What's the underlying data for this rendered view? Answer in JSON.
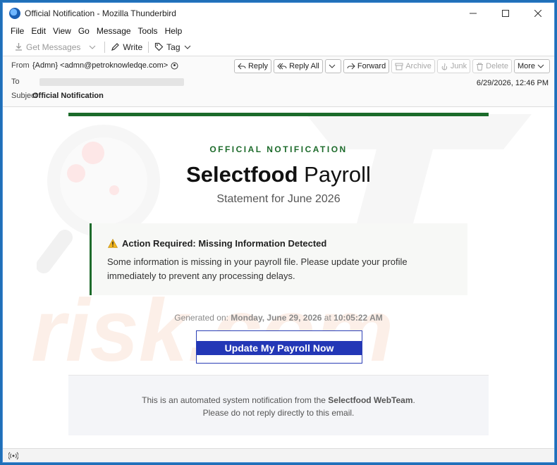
{
  "window": {
    "title": "Official Notification - Mozilla Thunderbird"
  },
  "menu": [
    "File",
    "Edit",
    "View",
    "Go",
    "Message",
    "Tools",
    "Help"
  ],
  "toolbar": {
    "get_messages": "Get Messages",
    "write": "Write",
    "tag": "Tag"
  },
  "header": {
    "from_label": "From",
    "from_value": "{Admn} <admn@petroknowledqe.com>",
    "to_label": "To",
    "subject_label": "Subject",
    "subject_value": "Official Notification",
    "date": "6/29/2026, 12:46 PM",
    "buttons": {
      "reply": "Reply",
      "reply_all": "Reply All",
      "forward": "Forward",
      "archive": "Archive",
      "junk": "Junk",
      "delete": "Delete",
      "more": "More"
    }
  },
  "email": {
    "kicker": "OFFICIAL NOTIFICATION",
    "brand_bold": "Selectfood",
    "brand_rest": " Payroll",
    "subtitle": "Statement for June 2026",
    "alert_title": "Action Required: Missing Information Detected",
    "alert_body": "Some information is missing in your payroll file. Please update your profile immediately to prevent any processing delays.",
    "generated_prefix": "Generated on: ",
    "generated_date": "Monday, June 29, 2026",
    "generated_mid": " at ",
    "generated_time": "10:05:22 AM",
    "cta": "Update My Payroll Now",
    "footer_pre": "This is an automated system notification from the ",
    "footer_team": "Selectfood WebTeam",
    "footer_post": ".",
    "footer_line2": "Please do not reply directly to this email."
  },
  "colors": {
    "accent_green": "#1b6b2a",
    "cta_blue": "#2337b6"
  }
}
